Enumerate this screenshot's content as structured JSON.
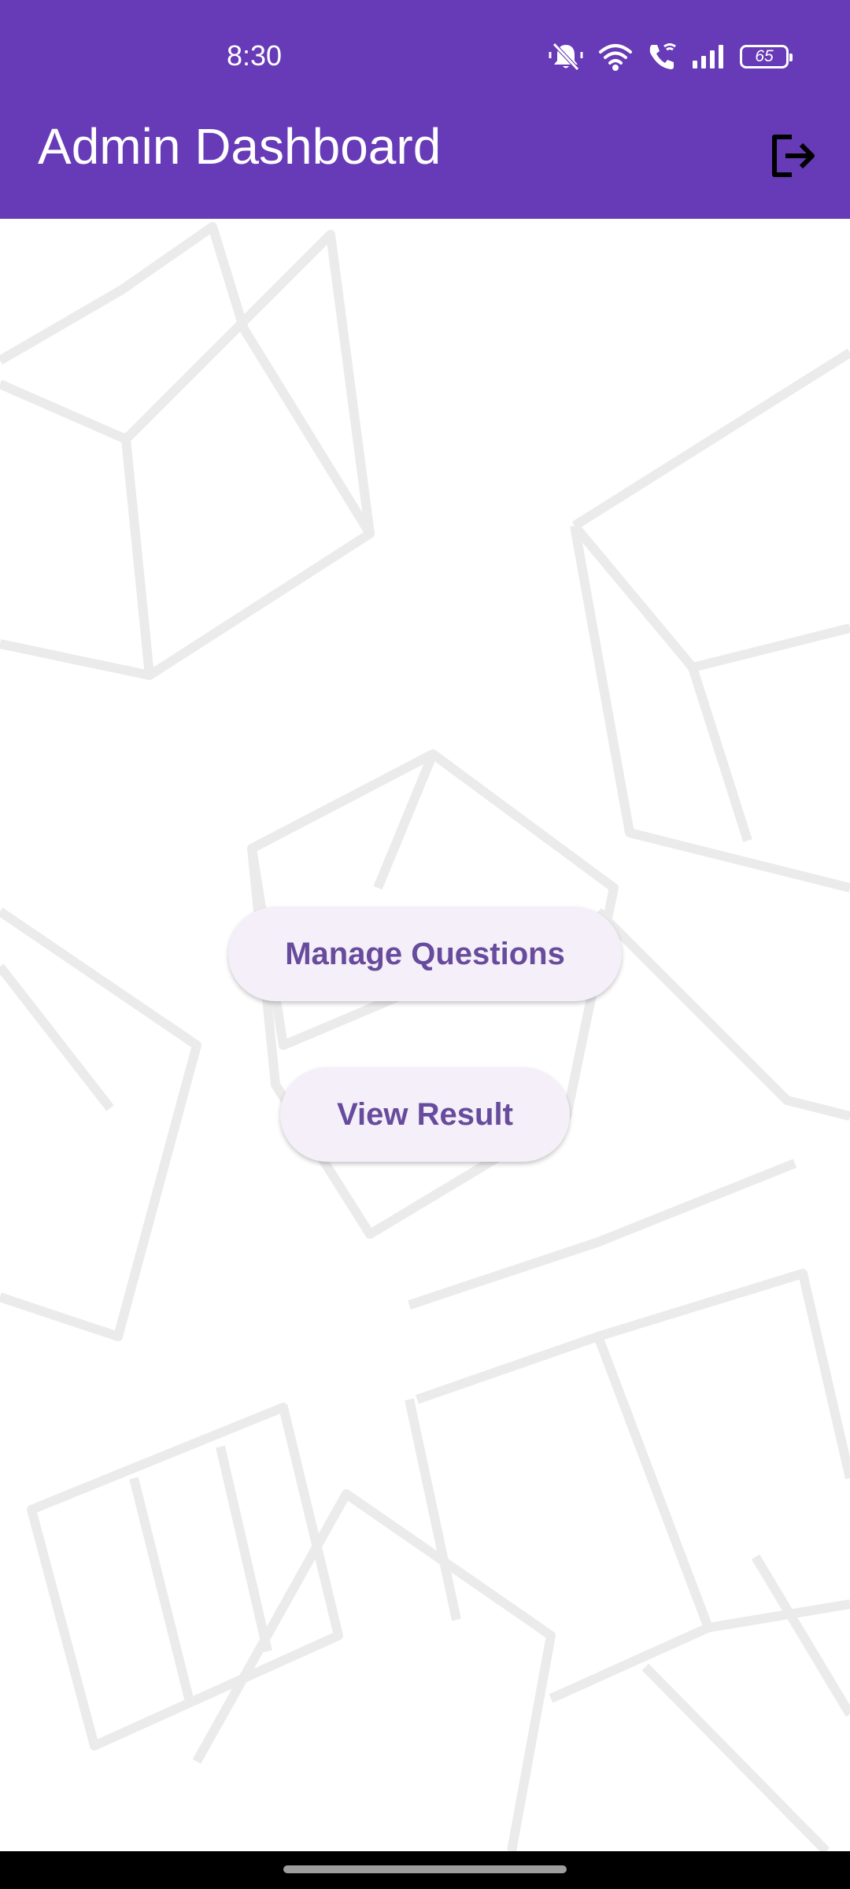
{
  "status_bar": {
    "time": "8:30",
    "battery_level": "65",
    "icons": [
      "bell-muted-icon",
      "wifi-icon",
      "wifi-call-icon",
      "signal-icon",
      "battery-icon"
    ]
  },
  "app_bar": {
    "title": "Admin Dashboard",
    "action_icon": "logout-icon"
  },
  "main": {
    "buttons": [
      {
        "label": "Manage Questions"
      },
      {
        "label": "View Result"
      }
    ]
  },
  "colors": {
    "app_bar": "#673ab7",
    "button_bg": "#f4eff8",
    "button_text": "#674b9c"
  }
}
